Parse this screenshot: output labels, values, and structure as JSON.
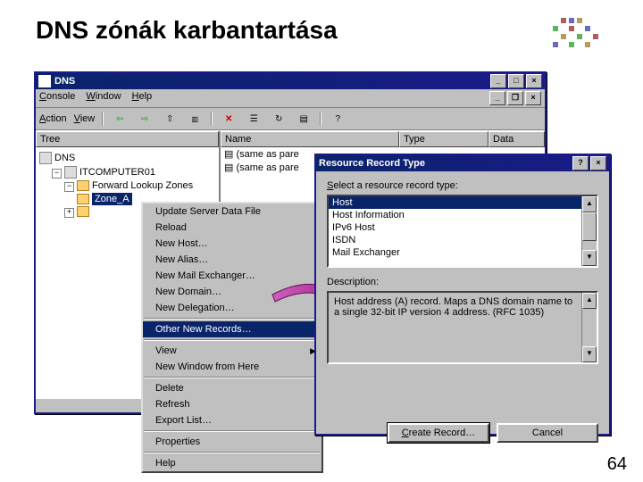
{
  "slide": {
    "title": "DNS zónák karbantartása",
    "page_number": "64"
  },
  "mmc": {
    "title": "DNS",
    "menus": {
      "console": "Console",
      "window": "Window",
      "help": "Help"
    },
    "toolbar": {
      "action": "Action",
      "view": "View"
    },
    "tree": {
      "header": "Tree",
      "root": "DNS",
      "server": "ITCOMPUTER01",
      "flz": "Forward Lookup Zones",
      "zone": "Zone_A"
    },
    "list": {
      "headers": {
        "name": "Name",
        "type": "Type",
        "data": "Data"
      },
      "rows": [
        {
          "name": "(same as pare",
          "type": "",
          "data": ""
        },
        {
          "name": "(same as pare",
          "type": "",
          "data": ""
        }
      ]
    }
  },
  "context_menu": {
    "items": [
      "Update Server Data File",
      "Reload",
      "New Host…",
      "New Alias…",
      "New Mail Exchanger…",
      "New Domain…",
      "New Delegation…",
      "Other New Records…",
      "View",
      "New Window from Here",
      "Delete",
      "Refresh",
      "Export List…",
      "Properties",
      "Help"
    ]
  },
  "dialog": {
    "title": "Resource Record Type",
    "select_label": "Select a resource record type:",
    "options": [
      "Host",
      "Host Information",
      "IPv6 Host",
      "ISDN",
      "Mail Exchanger"
    ],
    "desc_label": "Description:",
    "description": "Host address (A) record. Maps a DNS domain name to a single 32-bit IP version 4 address. (RFC 1035)",
    "create": "Create Record…",
    "cancel": "Cancel"
  }
}
